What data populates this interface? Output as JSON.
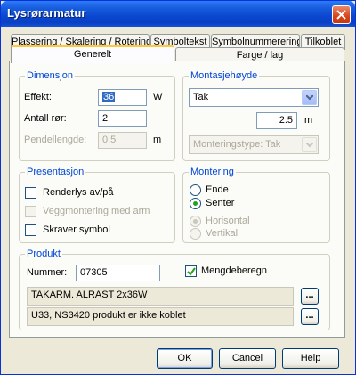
{
  "window": {
    "title": "Lysrørarmatur"
  },
  "tabs_row1": [
    "Plassering / Skalering / Rotering",
    "Symboltekst",
    "Symbolnummerering",
    "Tilkoblet"
  ],
  "tabs_row2": [
    "Generelt",
    "Farge / lag"
  ],
  "dimensjon": {
    "title": "Dimensjon",
    "effekt_label": "Effekt:",
    "effekt_value": "36",
    "effekt_unit": "W",
    "antall_label": "Antall rør:",
    "antall_value": "2",
    "pendellengde_label": "Pendellengde:",
    "pendellengde_value": "0.5",
    "pendellengde_unit": "m"
  },
  "montasjehoyde": {
    "title": "Montasjehøyde",
    "type_value": "Tak",
    "height_value": "2.5",
    "height_unit": "m",
    "monteringstype_value": "Monteringstype: Tak"
  },
  "presentasjon": {
    "title": "Presentasjon",
    "renderlys_label": "Renderlys av/på",
    "veggmontering_label": "Veggmontering med arm",
    "skraver_label": "Skraver symbol"
  },
  "montering": {
    "title": "Montering",
    "ende_label": "Ende",
    "senter_label": "Senter",
    "horisontal_label": "Horisontal",
    "vertikal_label": "Vertikal"
  },
  "produkt": {
    "title": "Produkt",
    "nummer_label": "Nummer:",
    "nummer_value": "07305",
    "mengdeberegn_label": "Mengdeberegn",
    "line1": "TAKARM. ALRAST 2x36W",
    "line2": "U33, NS3420 produkt er ikke koblet",
    "browse_label": "..."
  },
  "buttons": {
    "ok": "OK",
    "cancel": "Cancel",
    "help": "Help"
  },
  "colors": {
    "title_bar": "#0a47d0",
    "group_title": "#0046d5",
    "tab_highlight": "#ffc83c"
  }
}
